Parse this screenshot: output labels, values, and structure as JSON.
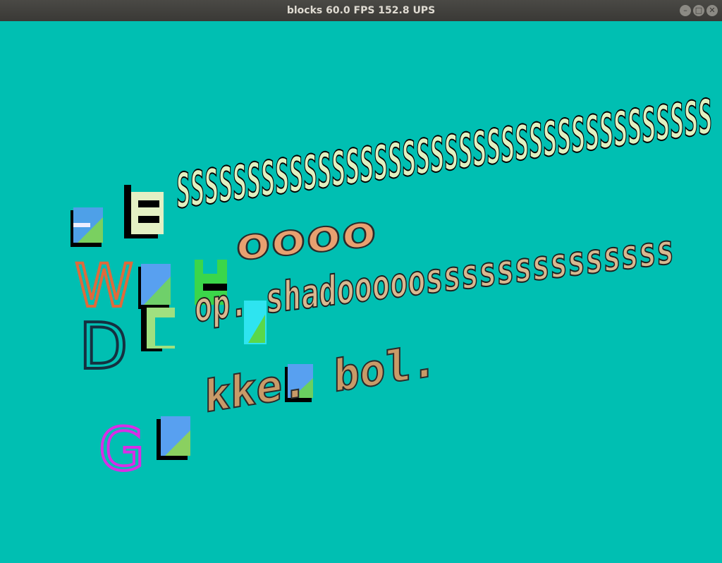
{
  "window": {
    "title": "blocks 60.0 FPS 152.8 UPS",
    "buttons": {
      "minimize_icon": "minimize-icon",
      "maximize_icon": "maximize-icon",
      "close_icon": "close-icon"
    }
  },
  "scene": {
    "background_color": "#00bfb2",
    "rows": [
      {
        "id": "row-ssss",
        "capital": "",
        "text": "LSSSSSSSSSSSSSSSSSSSSSSSSSSSSSSSSSSSSSS",
        "color": "#e0f0c0"
      },
      {
        "id": "row-weyoooo",
        "capital": "W",
        "text": "eyoooo",
        "color": "#e0a070"
      },
      {
        "id": "row-drop-shadow",
        "capital": "D",
        "text": "rop. shadooooossssssssssssss",
        "color": "#d4ecc8"
      },
      {
        "id": "row-gekke-bol",
        "capital": "G",
        "text": "ekke. bol.",
        "color": "#c0a060"
      }
    ]
  }
}
